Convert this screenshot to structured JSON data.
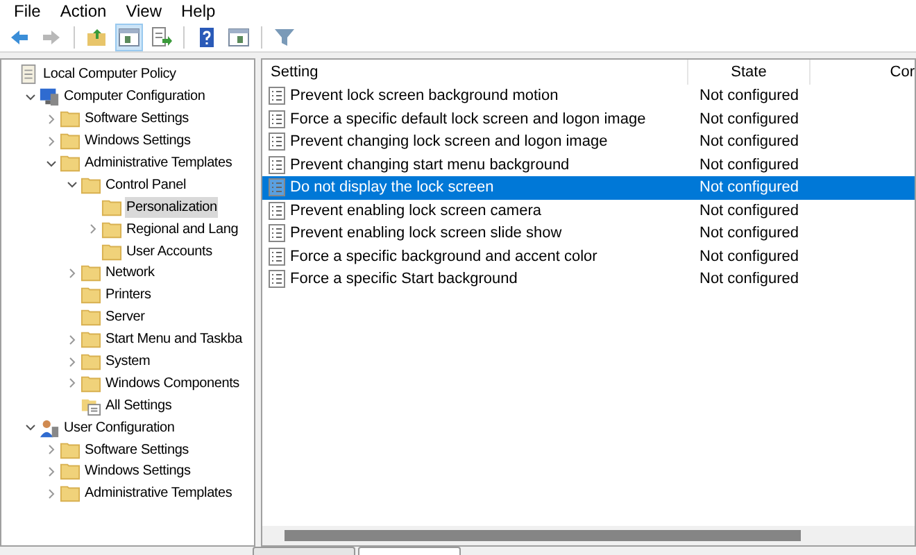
{
  "menu": [
    "File",
    "Action",
    "View",
    "Help"
  ],
  "toolbar": [
    {
      "kind": "back",
      "disabled": false
    },
    {
      "kind": "forward",
      "disabled": true
    },
    {
      "kind": "up",
      "disabled": false
    },
    {
      "kind": "tree",
      "selected": true
    },
    {
      "kind": "export",
      "disabled": false
    },
    {
      "kind": "help",
      "disabled": false
    },
    {
      "kind": "pane",
      "disabled": false
    },
    {
      "kind": "filter",
      "disabled": false
    }
  ],
  "tree": [
    {
      "label": "Local Computer Policy",
      "kind": "policy",
      "children": [
        {
          "label": "Computer Configuration",
          "kind": "computer",
          "expanded": true,
          "children": [
            {
              "label": "Software Settings",
              "kind": "folder",
              "expanded": false
            },
            {
              "label": "Windows Settings",
              "kind": "folder",
              "expanded": false
            },
            {
              "label": "Administrative Templates",
              "kind": "folder",
              "expanded": true,
              "children": [
                {
                  "label": "Control Panel",
                  "kind": "folder",
                  "expanded": true,
                  "children": [
                    {
                      "label": "Personalization",
                      "kind": "folder",
                      "selected": true
                    },
                    {
                      "label": "Regional and Lang",
                      "kind": "folder",
                      "expanded": false,
                      "selected": false
                    },
                    {
                      "label": "User Accounts",
                      "kind": "folder",
                      "selected": false
                    }
                  ]
                },
                {
                  "label": "Network",
                  "kind": "folder",
                  "expanded": false
                },
                {
                  "label": "Printers",
                  "kind": "folder"
                },
                {
                  "label": "Server",
                  "kind": "folder"
                },
                {
                  "label": "Start Menu and Taskba",
                  "kind": "folder",
                  "expanded": false
                },
                {
                  "label": "System",
                  "kind": "folder",
                  "expanded": false
                },
                {
                  "label": "Windows Components",
                  "kind": "folder",
                  "expanded": false
                },
                {
                  "label": "All Settings",
                  "kind": "settings"
                }
              ]
            }
          ]
        },
        {
          "label": "User Configuration",
          "kind": "user",
          "expanded": true,
          "children": [
            {
              "label": "Software Settings",
              "kind": "folder",
              "expanded": false
            },
            {
              "label": "Windows Settings",
              "kind": "folder",
              "expanded": false
            },
            {
              "label": "Administrative Templates",
              "kind": "folder",
              "expanded": false
            }
          ]
        }
      ]
    }
  ],
  "table": {
    "columns": [
      "Setting",
      "State",
      "Cor"
    ],
    "rows": [
      {
        "setting": "Prevent lock screen background motion",
        "state": "Not configured",
        "selected": false
      },
      {
        "setting": "Force a specific default lock screen and logon image",
        "state": "Not configured",
        "selected": false
      },
      {
        "setting": "Prevent changing lock screen and logon image",
        "state": "Not configured",
        "selected": false
      },
      {
        "setting": "Prevent changing start menu background",
        "state": "Not configured",
        "selected": false
      },
      {
        "setting": "Do not display the lock screen",
        "state": "Not configured",
        "selected": true
      },
      {
        "setting": "Prevent enabling lock screen camera",
        "state": "Not configured",
        "selected": false
      },
      {
        "setting": "Prevent enabling lock screen slide show",
        "state": "Not configured",
        "selected": false
      },
      {
        "setting": "Force a specific background and accent color",
        "state": "Not configured",
        "selected": false
      },
      {
        "setting": "Force a specific Start background",
        "state": "Not configured",
        "selected": false
      }
    ]
  },
  "bottom_tabs": [
    {
      "selected": false
    },
    {
      "selected": true
    }
  ]
}
